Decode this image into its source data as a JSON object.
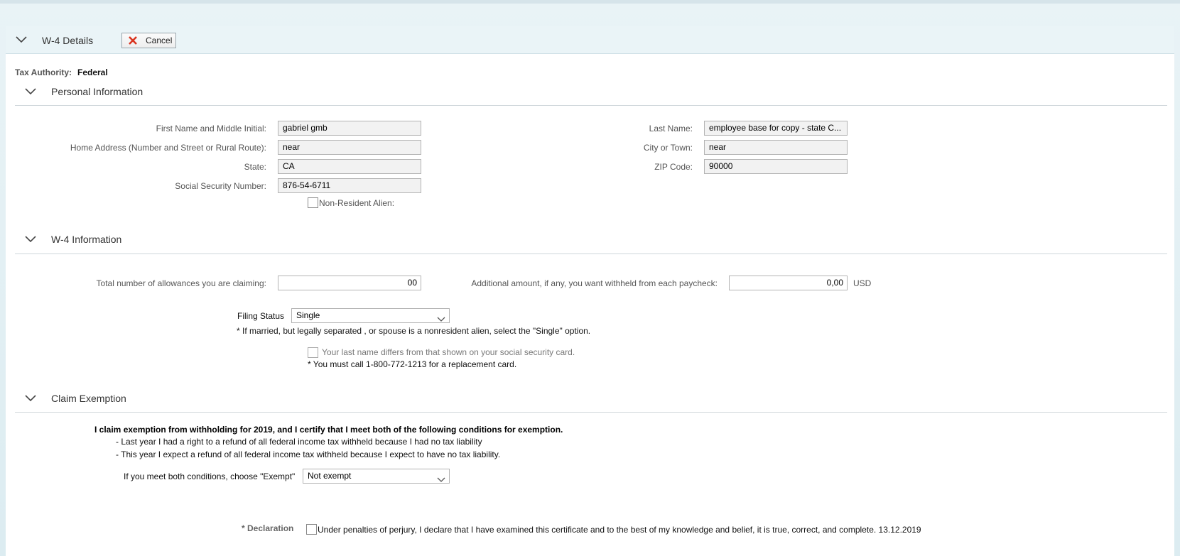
{
  "header": {
    "title": "W-4 Details",
    "cancel_label": "Cancel"
  },
  "tax_authority": {
    "label": "Tax Authority:",
    "value": "Federal"
  },
  "personal": {
    "title": "Personal Information",
    "first_name_label": "First Name and Middle Initial:",
    "first_name": "gabriel gmb",
    "last_name_label": "Last Name:",
    "last_name": "employee base for copy - state C...",
    "address_label": "Home Address (Number and Street or Rural Route):",
    "address": "near",
    "city_label": "City or Town:",
    "city": "near",
    "state_label": "State:",
    "state": "CA",
    "zip_label": "ZIP Code:",
    "zip": "90000",
    "ssn_label": "Social Security Number:",
    "ssn": "876-54-6711",
    "nra_label": "Non-Resident Alien:"
  },
  "w4": {
    "title": "W-4 Information",
    "allowances_label": "Total number of allowances you are claiming:",
    "allowances": "00",
    "additional_label": "Additional amount, if any, you want withheld from each paycheck:",
    "additional": "0,00",
    "currency": "USD",
    "filing_label": "Filing Status",
    "filing_value": "Single",
    "filing_note": "* If married, but legally separated , or spouse is a nonresident alien, select the \"Single\" option.",
    "lastname_diff_label": "Your last name differs from that shown on your social security card.",
    "call_note": "* You must call 1-800-772-1213 for a replacement card."
  },
  "exemption": {
    "title": "Claim Exemption",
    "claim_text": "I claim exemption from withholding for 2019, and I certify that I meet both of the following conditions for exemption.",
    "cond1": "- Last year I had a right to a refund of all federal income tax withheld because I had no tax liability",
    "cond2": "- This year I expect a refund of all federal income tax withheld because I expect to have no tax liability.",
    "choose_label": "If you meet both conditions, choose \"Exempt\"",
    "choose_value": "Not exempt"
  },
  "declaration": {
    "label": "* Declaration",
    "text": "Under penalties of perjury, I declare that I have examined this certificate and to the best of my knowledge and belief, it is true, correct, and complete. 13.12.2019"
  },
  "colors": {
    "accent_red": "#d9341f",
    "header_bg": "#eaf4f7"
  }
}
